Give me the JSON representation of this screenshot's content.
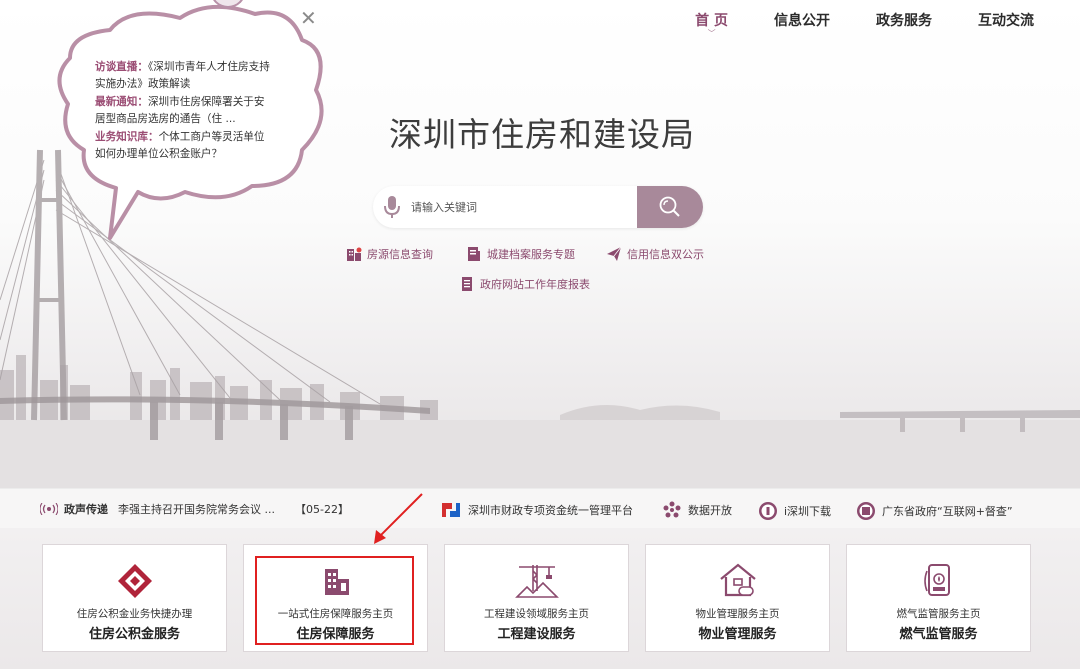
{
  "nav": {
    "items": [
      {
        "label": "首 页",
        "active": true
      },
      {
        "label": "信息公开",
        "active": false
      },
      {
        "label": "政务服务",
        "active": false
      },
      {
        "label": "互动交流",
        "active": false
      }
    ]
  },
  "bubble": {
    "items": [
      {
        "label": "访谈直播：",
        "text": "《深圳市青年人才住房支持实施办法》政策解读"
      },
      {
        "label": "最新通知：",
        "text": "深圳市住房保障署关于安居型商品房选房的通告（住 ..."
      },
      {
        "label": "业务知识库：",
        "text": "个体工商户等灵活单位如何办理单位公积金账户？"
      }
    ]
  },
  "site": {
    "title": "深圳市住房和建设局"
  },
  "search": {
    "placeholder": "请输入关键词"
  },
  "quick_links": [
    {
      "label": "房源信息查询",
      "icon": "building-icon"
    },
    {
      "label": "城建档案服务专题",
      "icon": "archive-icon"
    },
    {
      "label": "信用信息双公示",
      "icon": "paper-plane-icon"
    },
    {
      "label": "政府网站工作年度报表",
      "icon": "report-icon"
    }
  ],
  "ticker": {
    "tag": "政声传递",
    "headline": "李强主持召开国务院常务会议 ...",
    "date": "【05-22】",
    "links": [
      {
        "label": "深圳市财政专项资金统一管理平台",
        "icon": "finance-platform-icon"
      },
      {
        "label": "数据开放",
        "icon": "data-open-icon"
      },
      {
        "label": "i深圳下载",
        "icon": "i-shenzhen-icon"
      },
      {
        "label": "广东省政府“互联网+督查”",
        "icon": "supervision-icon"
      }
    ]
  },
  "cards": [
    {
      "sub": "住房公积金业务快捷办理",
      "main": "住房公积金服务",
      "icon": "provident-fund-icon"
    },
    {
      "sub": "一站式住房保障服务主页",
      "main": "住房保障服务",
      "icon": "housing-buildings-icon"
    },
    {
      "sub": "工程建设领域服务主页",
      "main": "工程建设服务",
      "icon": "construction-crane-icon"
    },
    {
      "sub": "物业管理服务主页",
      "main": "物业管理服务",
      "icon": "property-house-icon"
    },
    {
      "sub": "燃气监管服务主页",
      "main": "燃气监管服务",
      "icon": "gas-meter-icon"
    }
  ],
  "colors": {
    "accent": "#8b4a6e",
    "search_button": "#a8899a",
    "annotation": "#e02020"
  }
}
